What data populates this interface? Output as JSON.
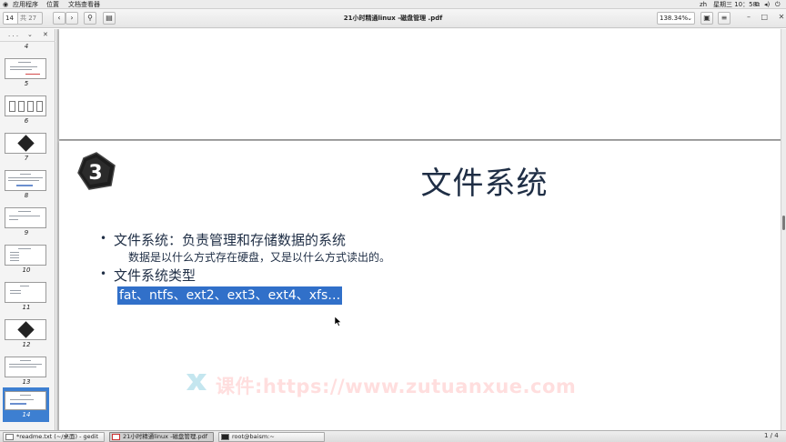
{
  "top_panel": {
    "applications": "应用程序",
    "places": "位置",
    "app_name": "文档查看器",
    "lang": "zh",
    "clock": "星期三 10：58"
  },
  "toolbar": {
    "page_number": "14",
    "page_of": "共 27",
    "document_title": "21小时精通linux -磁盘管理 .pdf",
    "zoom": "138.34%"
  },
  "sidebar": {
    "thumbnails": [
      {
        "num": "4"
      },
      {
        "num": "5"
      },
      {
        "num": "6"
      },
      {
        "num": "7"
      },
      {
        "num": "8"
      },
      {
        "num": "9"
      },
      {
        "num": "10"
      },
      {
        "num": "11"
      },
      {
        "num": "12"
      },
      {
        "num": "13"
      },
      {
        "num": "14"
      }
    ]
  },
  "slide": {
    "badge_number": "3",
    "title": "文件系统",
    "bullet1": "文件系统：负责管理和存储数据的系统",
    "bullet1_sub": "数据是以什么方式存在硬盘，又是以什么方式读出的。",
    "bullet2": "文件系统类型",
    "fs_types": "fat、ntfs、ext2、ext3、ext4、xfs…",
    "watermark": "课件:https://www.zutuanxue.com"
  },
  "taskbar": {
    "tasks": [
      {
        "label": "*readme.txt (~/桌面) - gedit"
      },
      {
        "label": "21小时精通linux -磁盘管理.pdf"
      },
      {
        "label": "root@baism:~"
      }
    ],
    "pager": "1 / 4"
  },
  "colors": {
    "selection": "#3170c9",
    "slide_text": "#1f2e45",
    "watermark": "#ff6b6b"
  }
}
